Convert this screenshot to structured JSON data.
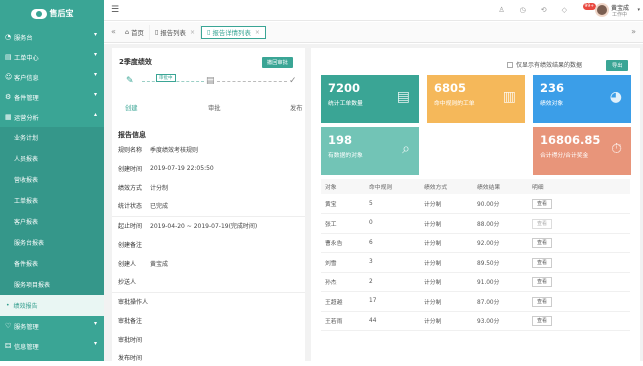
{
  "brand": {
    "name": "售后宝"
  },
  "sidebar": {
    "items": [
      {
        "icon": "◔",
        "label": "服务台",
        "arrow": "▾"
      },
      {
        "icon": "▤",
        "label": "工单中心",
        "arrow": "▾"
      },
      {
        "icon": "☺",
        "label": "客户信息",
        "arrow": "▾"
      },
      {
        "icon": "⚙",
        "label": "备件管理",
        "arrow": "▾"
      },
      {
        "icon": "▦",
        "label": "运营分析",
        "arrow": "▴"
      }
    ],
    "sub_items": [
      "业务计划",
      "人员报表",
      "营收报表",
      "工单报表",
      "客户报表",
      "服务台报表",
      "备件报表",
      "服务项目报表",
      "绩效报告"
    ],
    "bottom_items": [
      {
        "icon": "♡",
        "label": "服务管理",
        "arrow": "▾"
      },
      {
        "icon": "⚃",
        "label": "信息管理",
        "arrow": "▾"
      }
    ]
  },
  "topbar": {
    "badge": "99+",
    "user_name": "黄宝成",
    "user_status": "工作中",
    "icons": [
      "♙",
      "◷",
      "⟲",
      "◇"
    ]
  },
  "tabs": {
    "home": "首页",
    "list": "报告列表",
    "detail": "报告详情列表"
  },
  "left": {
    "title": "2季度绩效",
    "action": "撤回审批",
    "flow_label": "审批中",
    "steps": [
      "创建",
      "审批",
      "发布"
    ],
    "info_title": "报告信息",
    "fields": [
      {
        "k": "规则名称",
        "v": "季度绩效考核规则"
      },
      {
        "k": "创建时间",
        "v": "2019-07-19 22:05:50"
      },
      {
        "k": "绩效方式",
        "v": "计分制"
      },
      {
        "k": "统计状态",
        "v": "已完成"
      },
      {
        "k": "起止时间",
        "v": "2019-04-20 ~ 2019-07-19(完成时间)"
      },
      {
        "k": "创建备注",
        "v": ""
      },
      {
        "k": "创建人",
        "v": "黄宝成"
      },
      {
        "k": "抄送人",
        "v": ""
      },
      {
        "k": "审批操作人",
        "v": ""
      },
      {
        "k": "审批备注",
        "v": ""
      },
      {
        "k": "审批时间",
        "v": ""
      },
      {
        "k": "发布时间",
        "v": ""
      }
    ]
  },
  "right": {
    "only_label": "仅显示有绩效结果的数据",
    "export": "导出",
    "cards": [
      {
        "num": "7200",
        "lbl": "统计工单数量",
        "color": "#3aa595",
        "icon": "▤"
      },
      {
        "num": "6805",
        "lbl": "命中规则的工单",
        "color": "#f5b85a",
        "icon": "▥"
      },
      {
        "num": "236",
        "lbl": "绩效对象",
        "color": "#3b9ee8",
        "icon": "◕"
      },
      {
        "num": "198",
        "lbl": "有数据的对象",
        "color": "#72c4b6",
        "icon": "⌕"
      },
      {
        "num": "16806.85",
        "lbl": "合计得分/合计奖金",
        "color": "#e8957a",
        "icon": "⏱"
      }
    ],
    "headers": [
      "对象",
      "命中规则",
      "绩效方式",
      "绩效结果",
      "明细"
    ],
    "rows": [
      {
        "name": "黄宝",
        "hits": "5",
        "mode": "计分制",
        "result": "90.00分",
        "view": "查看",
        "enabled": true
      },
      {
        "name": "张工",
        "hits": "0",
        "mode": "计分制",
        "result": "88.00分",
        "view": "查看",
        "enabled": false
      },
      {
        "name": "曹永告",
        "hits": "6",
        "mode": "计分制",
        "result": "92.00分",
        "view": "查看",
        "enabled": true
      },
      {
        "name": "刘雪",
        "hits": "3",
        "mode": "计分制",
        "result": "89.50分",
        "view": "查看",
        "enabled": true
      },
      {
        "name": "孙杰",
        "hits": "2",
        "mode": "计分制",
        "result": "91.00分",
        "view": "查看",
        "enabled": true
      },
      {
        "name": "王超越",
        "hits": "17",
        "mode": "计分制",
        "result": "87.00分",
        "view": "查看",
        "enabled": true
      },
      {
        "name": "王若雨",
        "hits": "44",
        "mode": "计分制",
        "result": "93.00分",
        "view": "查看",
        "enabled": true
      }
    ]
  }
}
